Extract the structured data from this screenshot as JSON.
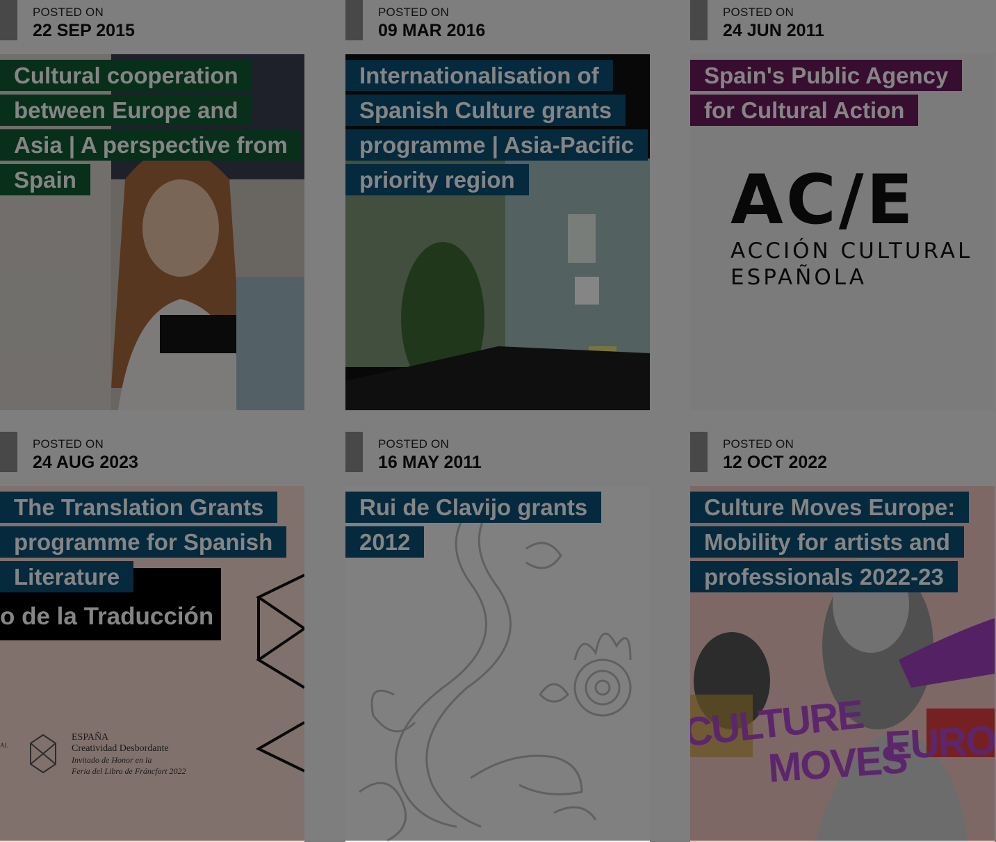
{
  "posted_label": "POSTED ON",
  "cards": [
    {
      "date": "22 SEP 2015",
      "title": "Cultural cooperation between Europe and Asia | A perspective from Spain",
      "title_color": "#0e5a32"
    },
    {
      "date": "09 MAR 2016",
      "title": "Internationalisation of Spanish Culture grants programme | Asia-Pacific priority region",
      "title_color": "#0b4f75"
    },
    {
      "date": "24 JUN 2011",
      "title": "Spain's Public Agency for Cultural Action",
      "title_color": "#6a1a5c",
      "logo": {
        "main": "AC/E",
        "line1": "ACCIÓN CULTURAL",
        "line2": "ESPAÑOLA"
      }
    },
    {
      "date": "24 AUG 2023",
      "title": "The Translation Grants programme for Spanish Literature",
      "title_color": "#0b4f75",
      "image_text": {
        "banner": "o de la Traducción",
        "espana": "ESPAÑA",
        "line1": "Creatividad Desbordante",
        "line2": "Invitado de Honor en la",
        "line3": "Feria del Libro de Fráncfort 2022",
        "edge": "AL"
      }
    },
    {
      "date": "16 MAY 2011",
      "title": "Rui de Clavijo grants 2012",
      "title_color": "#0b4f75"
    },
    {
      "date": "12 OCT 2022",
      "title": "Culture Moves Europe: Mobility for artists and professionals 2022-23",
      "title_color": "#0b4f75",
      "image_text": {
        "word1": "CULTURE",
        "word2": "MOVES",
        "word3": "EURO"
      }
    }
  ]
}
